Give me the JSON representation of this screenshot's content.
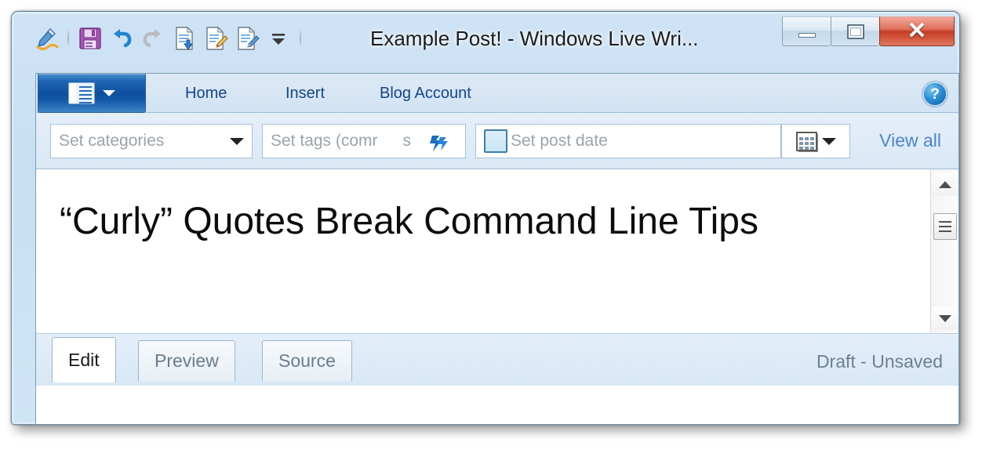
{
  "window": {
    "title": "Example Post! - Windows Live Wri...",
    "controls": {
      "minimize": "minimize-button",
      "maximize": "maximize-button",
      "close_glyph": "✕"
    }
  },
  "quick_access_toolbar": {
    "icons": [
      {
        "name": "writer-logo-icon",
        "glyph": "✒"
      },
      {
        "name": "save-icon",
        "glyph": "💾"
      },
      {
        "name": "undo-icon",
        "glyph": "↶"
      },
      {
        "name": "redo-icon",
        "glyph": "↷"
      },
      {
        "name": "publish-icon",
        "glyph": "⬆"
      },
      {
        "name": "post-draft-icon",
        "glyph": "✎"
      },
      {
        "name": "save-local-draft-icon",
        "glyph": "✏"
      },
      {
        "name": "customize-qat-dropdown-icon",
        "glyph": "▾"
      }
    ]
  },
  "ribbon": {
    "app_menu_label": "",
    "tabs": [
      {
        "label": "Home",
        "active": false
      },
      {
        "label": "Insert",
        "active": false
      },
      {
        "label": "Blog Account",
        "active": false
      }
    ],
    "help_glyph": "?"
  },
  "properties_bar": {
    "categories": {
      "placeholder": "Set categories",
      "value": ""
    },
    "tags": {
      "placeholder": "Set tags (comma separated)",
      "visible_text": "Set tags (comr",
      "trailing_text": "s"
    },
    "post_date": {
      "label": "Set post date",
      "checked": false
    },
    "view_all_label": "View all"
  },
  "editor": {
    "post_title": "“Curly” Quotes Break Command Line Tips",
    "body": ""
  },
  "view_tabs": [
    {
      "label": "Edit",
      "active": true
    },
    {
      "label": "Preview",
      "active": false
    },
    {
      "label": "Source",
      "active": false
    }
  ],
  "status": {
    "text": "Draft - Unsaved"
  },
  "colors": {
    "accent_blue": "#13458a",
    "link_blue": "#4b87c7",
    "close_red": "#c33c26",
    "frame_blue": "#cfe3f5",
    "status_gray": "#6d7f90"
  }
}
